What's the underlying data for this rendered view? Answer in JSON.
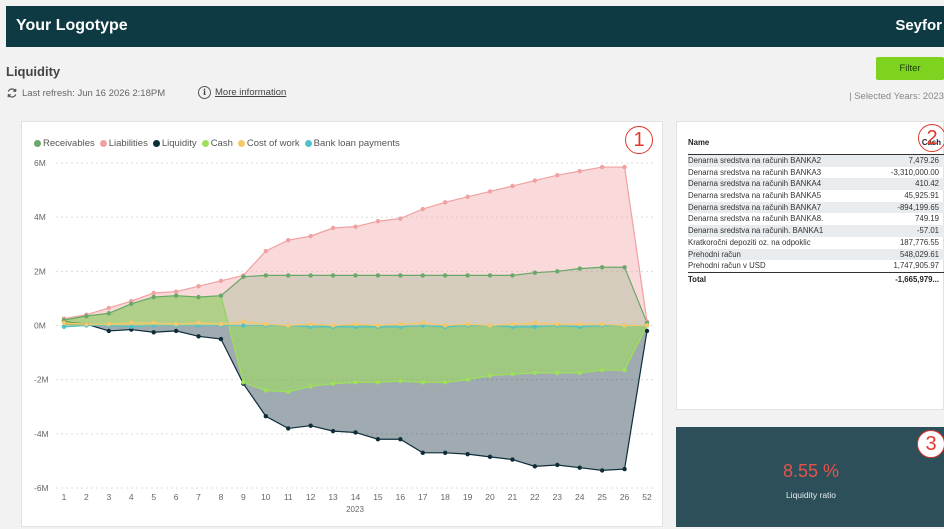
{
  "header": {
    "logo": "Your Logotype",
    "brand": "Seyfor"
  },
  "page": {
    "title": "Liquidity",
    "last_refresh": "Last refresh: Jun 16 2026 2:18PM",
    "more_info": "More information",
    "filter_label": "Filter",
    "selected_years": "| Selected Years: 2023"
  },
  "badges": {
    "chart": "1",
    "table": "2",
    "kpi": "3"
  },
  "icons": {
    "refresh": "refresh-icon",
    "info": "info-icon"
  },
  "colors": {
    "topbar": "#0e3a44",
    "filter": "#7ed321",
    "receivables": "#6aa76a",
    "liabilities": "#f0a1a1",
    "liquidity": "#0e2d3a",
    "cash": "#9ee05a",
    "cost_of_work": "#f5c96b",
    "bank_loan": "#52c2c9",
    "kpi_bg": "#2c4f5a",
    "kpi_value": "#e5534b"
  },
  "chart_data": {
    "type": "area",
    "x": [
      "1",
      "2",
      "3",
      "4",
      "5",
      "6",
      "7",
      "8",
      "9",
      "10",
      "11",
      "12",
      "13",
      "14",
      "15",
      "16",
      "17",
      "18",
      "19",
      "20",
      "21",
      "22",
      "23",
      "24",
      "25",
      "26",
      "52"
    ],
    "xlabel": "2023",
    "ylim": [
      -6,
      6
    ],
    "yticks": [
      -6,
      -4,
      -2,
      0,
      2,
      4,
      6
    ],
    "ytick_labels": [
      "-6M",
      "-4M",
      "-2M",
      "0M",
      "2M",
      "4M",
      "6M"
    ],
    "legend_position": "top-left",
    "series": [
      {
        "name": "Receivables",
        "color": "#6aa76a",
        "values": [
          0.2,
          0.35,
          0.45,
          0.8,
          1.05,
          1.1,
          1.05,
          1.1,
          1.8,
          1.85,
          1.85,
          1.85,
          1.85,
          1.85,
          1.85,
          1.85,
          1.85,
          1.85,
          1.85,
          1.85,
          1.85,
          1.95,
          2.0,
          2.1,
          2.15,
          2.15,
          0.1
        ]
      },
      {
        "name": "Liabilities",
        "color": "#f0a1a1",
        "values": [
          0.25,
          0.4,
          0.65,
          0.9,
          1.2,
          1.25,
          1.45,
          1.65,
          1.85,
          2.75,
          3.15,
          3.3,
          3.6,
          3.65,
          3.85,
          3.95,
          4.3,
          4.55,
          4.75,
          4.95,
          5.15,
          5.35,
          5.55,
          5.7,
          5.85,
          5.85,
          0.15
        ]
      },
      {
        "name": "Liquidity",
        "color": "#0e2d3a",
        "values": [
          0.15,
          0.05,
          -0.2,
          -0.15,
          -0.25,
          -0.2,
          -0.4,
          -0.5,
          -2.15,
          -3.35,
          -3.8,
          -3.7,
          -3.9,
          -3.95,
          -4.2,
          -4.2,
          -4.7,
          -4.7,
          -4.75,
          -4.85,
          -4.95,
          -5.2,
          -5.15,
          -5.25,
          -5.35,
          -5.3,
          -0.2
        ]
      },
      {
        "name": "Cash",
        "color": "#9ee05a",
        "values": [
          0.2,
          0.35,
          0.45,
          0.8,
          1.05,
          1.1,
          1.05,
          1.1,
          -2.1,
          -2.4,
          -2.45,
          -2.25,
          -2.15,
          -2.1,
          -2.1,
          -2.05,
          -2.1,
          -2.1,
          -2.0,
          -1.85,
          -1.8,
          -1.75,
          -1.75,
          -1.75,
          -1.65,
          -1.65,
          0.0
        ]
      },
      {
        "name": "Cost of work",
        "color": "#f5c96b",
        "values": [
          0.1,
          0.05,
          0.05,
          0.1,
          0.1,
          0.05,
          0.1,
          0.05,
          0.15,
          0.05,
          0.0,
          0.05,
          0.0,
          0.05,
          0.0,
          0.05,
          0.1,
          0.0,
          0.05,
          0.0,
          0.05,
          0.1,
          0.05,
          0.05,
          0.05,
          0.0,
          0.0
        ]
      },
      {
        "name": "Bank loan payments",
        "color": "#52c2c9",
        "values": [
          -0.05,
          0.0,
          0.0,
          -0.05,
          0.0,
          0.0,
          0.0,
          0.0,
          0.0,
          0.0,
          0.0,
          -0.05,
          -0.05,
          -0.05,
          -0.05,
          -0.05,
          0.0,
          -0.05,
          0.0,
          0.0,
          -0.05,
          -0.05,
          0.0,
          -0.05,
          0.0,
          0.0,
          0.0
        ]
      }
    ]
  },
  "table": {
    "headers": [
      "Name",
      "Cash"
    ],
    "rows": [
      [
        "Denarna sredstva na računih BANKA2",
        "7,479.26"
      ],
      [
        "Denarna sredstva na računih BANKA3",
        "-3,310,000.00"
      ],
      [
        "Denarna sredstva na računih BANKA4",
        "410.42"
      ],
      [
        "Denarna sredstva na računih BANKA5",
        "45,925.91"
      ],
      [
        "Denarna sredstva na računih BANKA7",
        "-894,199.65"
      ],
      [
        "Denarna sredstva na računih BANKA8.",
        "749.19"
      ],
      [
        "Denarna sredstva na računih. BANKA1",
        "-57.01"
      ],
      [
        "Kratkoročni depoziti oz. na odpoklic",
        "187,776.55"
      ],
      [
        "Prehodni račun",
        "548,029.61"
      ],
      [
        "Prehodni račun   v USD",
        "1,747,905.97"
      ]
    ],
    "total_label": "Total",
    "total_value": "-1,665,979..."
  },
  "kpi": {
    "value": "8.55 %",
    "label": "Liquidity ratio"
  }
}
